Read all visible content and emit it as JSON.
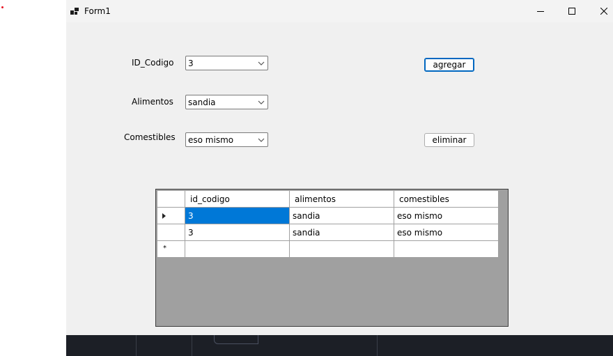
{
  "window": {
    "title": "Form1"
  },
  "form": {
    "fields": [
      {
        "label": "ID_Codigo",
        "value": "3"
      },
      {
        "label": "Alimentos",
        "value": "sandia"
      },
      {
        "label": "Comestibles",
        "value": "eso mismo"
      }
    ],
    "buttons": {
      "add": "agregar",
      "delete": "eliminar"
    }
  },
  "grid": {
    "columns": [
      "id_codigo",
      "alimentos",
      "comestibles"
    ],
    "rows": [
      [
        "3",
        "sandia",
        "eso mismo"
      ],
      [
        "3",
        "sandia",
        "eso mismo"
      ]
    ],
    "new_row_marker": "*"
  },
  "icons": {
    "app": "form-icon",
    "minimize": "minimize-icon",
    "maximize": "maximize-icon",
    "close": "close-icon",
    "dropdown": "chevron-down-icon",
    "current_row": "row-pointer-icon"
  },
  "colors": {
    "selection": "#0078d7",
    "form_bg": "#f0f0f0",
    "grid_bg": "#a0a0a0",
    "focus_border": "#0067c0"
  }
}
